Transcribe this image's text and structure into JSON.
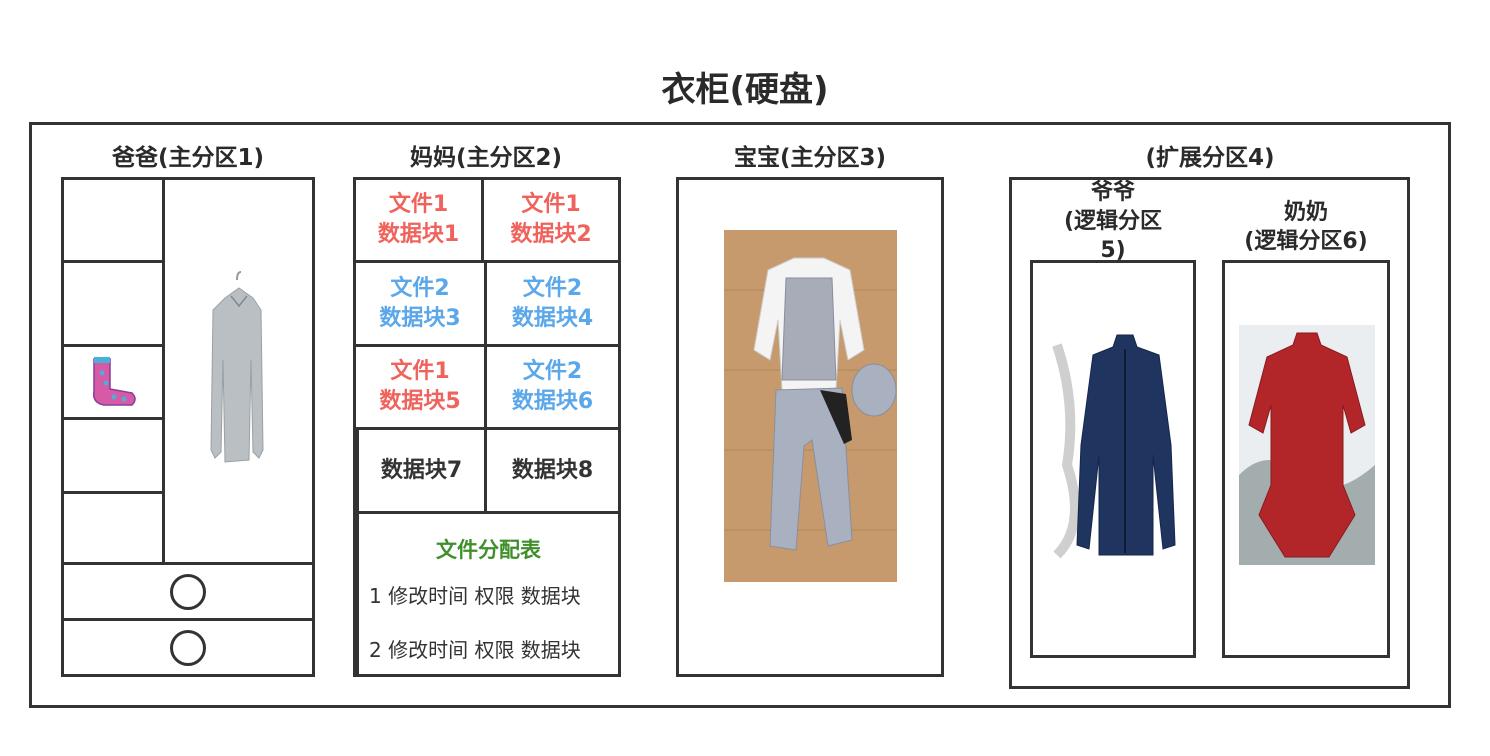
{
  "title": "衣柜(硬盘)",
  "partitions": {
    "dad": {
      "label": "爸爸(主分区1)",
      "items": [
        "sweater",
        "socks",
        "shoe-circle",
        "shoe-circle"
      ]
    },
    "mom": {
      "label": "妈妈(主分区2)",
      "blocks": [
        {
          "file": "文件1",
          "block": "数据块1",
          "color": "#f0635c"
        },
        {
          "file": "文件1",
          "block": "数据块2",
          "color": "#f0635c"
        },
        {
          "file": "文件2",
          "block": "数据块3",
          "color": "#5aa7ea"
        },
        {
          "file": "文件2",
          "block": "数据块4",
          "color": "#5aa7ea"
        },
        {
          "file": "文件1",
          "block": "数据块5",
          "color": "#f0635c"
        },
        {
          "file": "文件2",
          "block": "数据块6",
          "color": "#5aa7ea"
        },
        {
          "file": "",
          "block": "数据块7",
          "color": "#333333"
        },
        {
          "file": "",
          "block": "数据块8",
          "color": "#333333"
        }
      ],
      "fat": {
        "title": "文件分配表",
        "rows": [
          "1 修改时间 权限 数据块",
          "2 修改时间 权限 数据块"
        ],
        "title_color": "#3f8f2a"
      }
    },
    "baby": {
      "label": "宝宝(主分区3)",
      "item": "baby-outfit"
    },
    "extended": {
      "label": "(扩展分区4)",
      "grandpa": {
        "name": "爷爷",
        "sub": "(逻辑分区",
        "num": "5)",
        "item": "blue-tang-jacket"
      },
      "grandma": {
        "name": "奶奶",
        "sub": "(逻辑分区6)",
        "item": "red-tang-jacket"
      }
    }
  }
}
